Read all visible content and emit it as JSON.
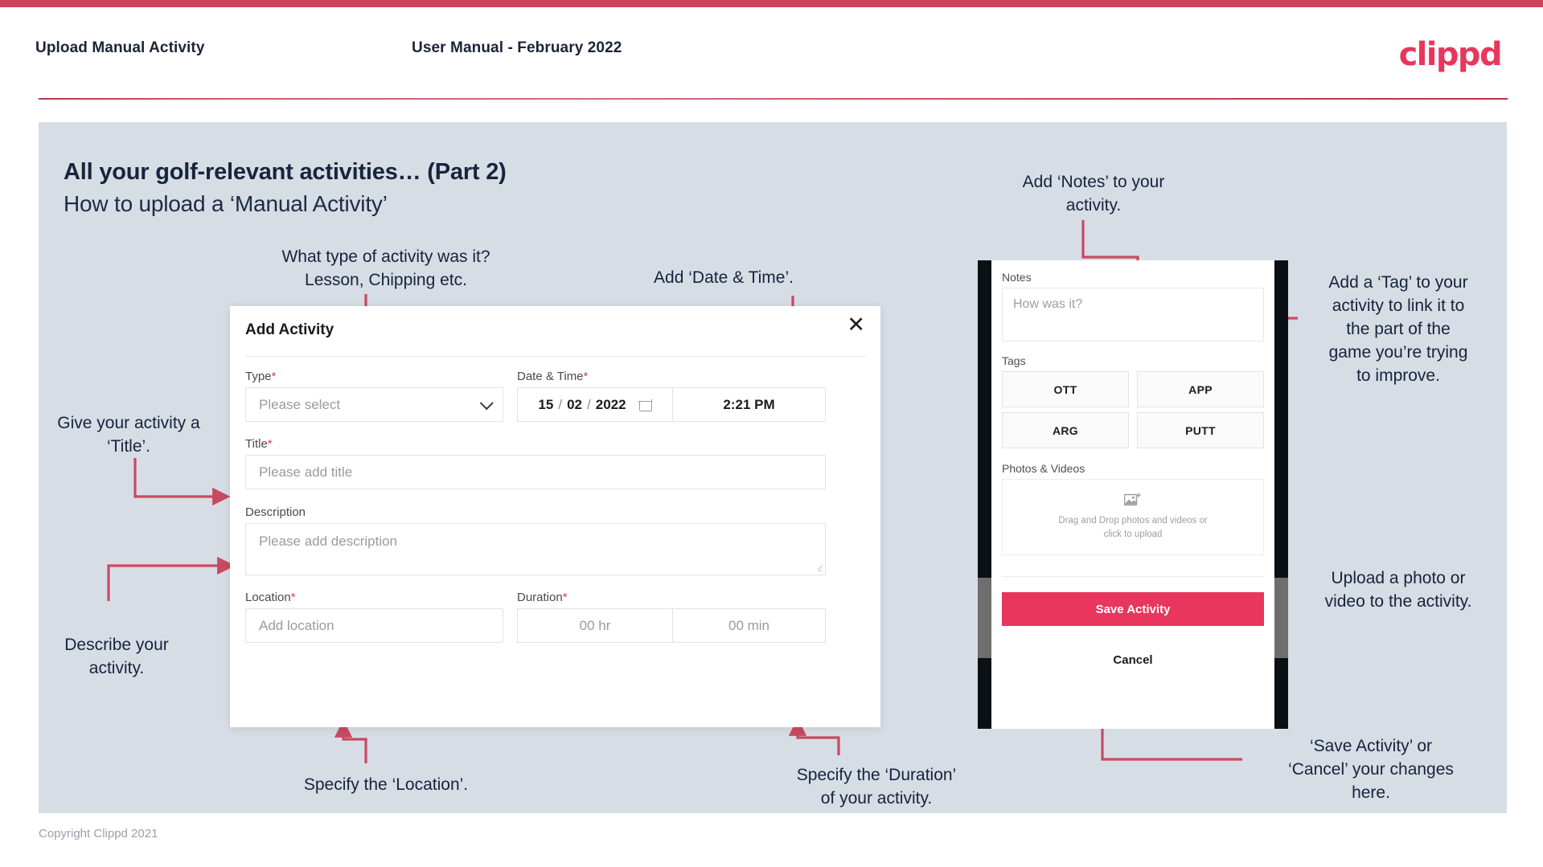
{
  "header": {
    "left_title": "Upload Manual Activity",
    "center_title": "User Manual - February 2022",
    "logo": "clippd",
    "brand_color": "#e8365d",
    "rule_color": "#c63b52"
  },
  "slide": {
    "title": "All your golf-relevant activities… (Part 2)",
    "subtitle": "How to upload a ‘Manual Activity’",
    "background_color": "#d7dde5"
  },
  "annotations": {
    "type": "What type of activity was it?\nLesson, Chipping etc.",
    "type_line1": "What type of activity was it?",
    "type_line2": "Lesson, Chipping etc.",
    "datetime": "Add ‘Date & Time’.",
    "title_l1": "Give your activity a",
    "title_l2": "‘Title’.",
    "describe_l1": "Describe your",
    "describe_l2": "activity.",
    "location": "Specify the ‘Location’.",
    "duration_l1": "Specify the ‘Duration’",
    "duration_l2": "of your activity.",
    "notes_l1": "Add ‘Notes’ to your",
    "notes_l2": "activity.",
    "tag_l1": "Add a ‘Tag’ to your",
    "tag_l2": "activity to link it to",
    "tag_l3": "the part of the",
    "tag_l4": "game you’re trying",
    "tag_l5": "to improve.",
    "upload_l1": "Upload a photo or",
    "upload_l2": "video to the activity.",
    "save_l1": "‘Save Activity’ or",
    "save_l2": "‘Cancel’ your changes",
    "save_l3": "here.",
    "arrow_color": "#c84a62"
  },
  "dialog": {
    "title": "Add Activity",
    "close_icon": "close-icon",
    "fields": {
      "type_label": "Type",
      "type_required": "*",
      "type_placeholder": "Please select",
      "datetime_label": "Date & Time",
      "datetime_required": "*",
      "date_day": "15",
      "date_month": "02",
      "date_year": "2022",
      "date_sep": "/",
      "calendar_icon": "calendar-icon",
      "time_value": "2:21 PM",
      "title_label": "Title",
      "title_required": "*",
      "title_placeholder": "Please add title",
      "description_label": "Description",
      "description_placeholder": "Please add description",
      "location_label": "Location",
      "location_required": "*",
      "location_placeholder": "Add location",
      "duration_label": "Duration",
      "duration_required": "*",
      "duration_hours": "00 hr",
      "duration_minutes": "00 min"
    }
  },
  "phone": {
    "notes_label": "Notes",
    "notes_placeholder": "How was it?",
    "tags_label": "Tags",
    "tags": [
      "OTT",
      "APP",
      "ARG",
      "PUTT"
    ],
    "photos_label": "Photos & Videos",
    "upload_icon": "image-add-icon",
    "upload_text_l1": "Drag and Drop photos and videos or",
    "upload_text_l2": "click to upload",
    "save_label": "Save Activity",
    "cancel_label": "Cancel",
    "save_color": "#e8365d"
  },
  "footer": {
    "copyright": "Copyright Clippd 2021"
  }
}
